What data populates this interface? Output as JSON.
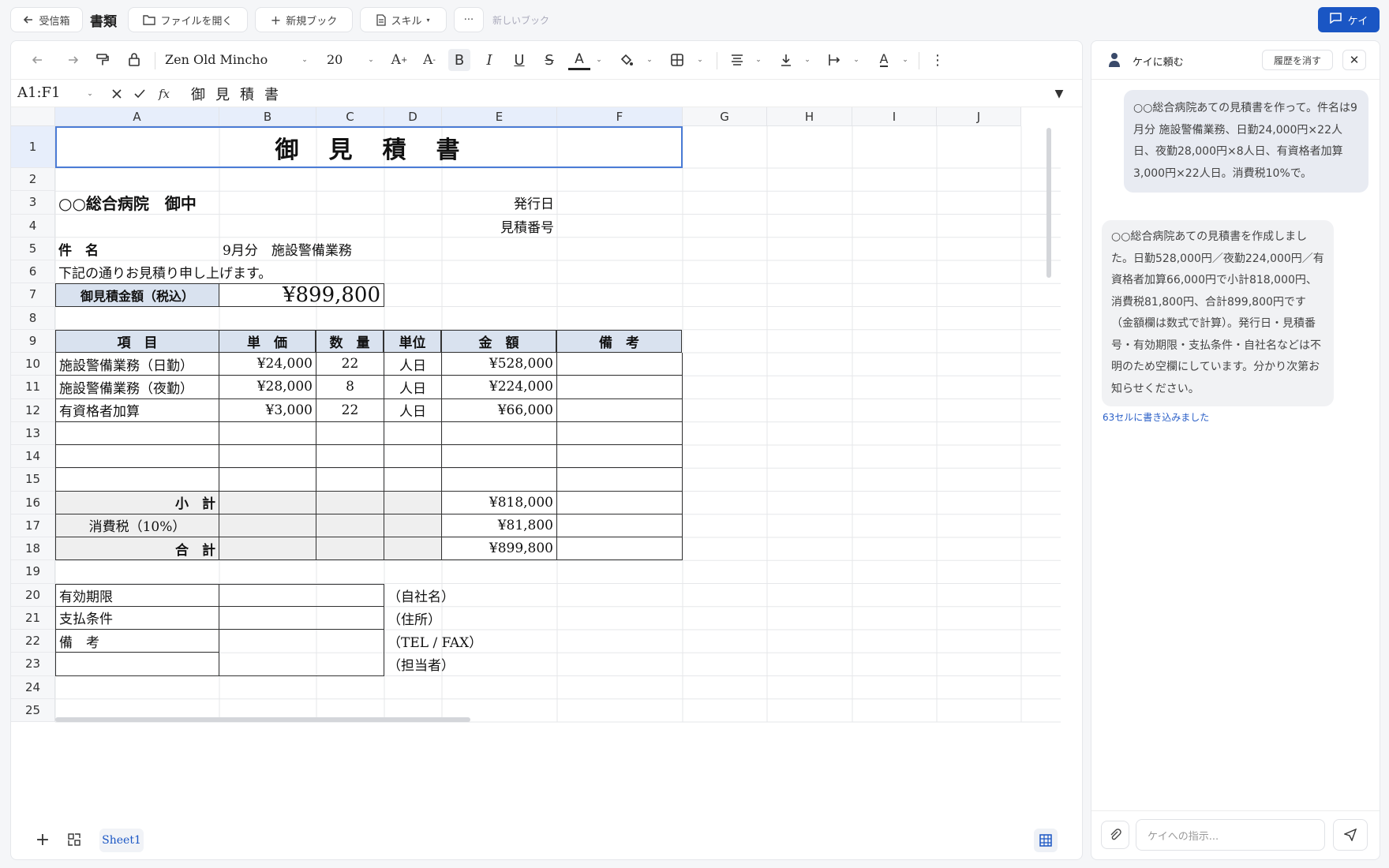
{
  "topbar": {
    "back_label": "受信箱",
    "app_title": "書類",
    "open_file": "ファイルを開く",
    "new_book": "新規ブック",
    "skill": "スキル",
    "more": "···",
    "doc_name": "新しいブック",
    "kei_button": "ケイ"
  },
  "toolbar": {
    "font_name": "Zen Old Mincho",
    "font_size": "20"
  },
  "formula_bar": {
    "cell_ref": "A1:F1",
    "fx": "fx",
    "content": "御見積書"
  },
  "grid": {
    "columns": [
      "A",
      "B",
      "C",
      "D",
      "E",
      "F",
      "G",
      "H",
      "I",
      "J"
    ],
    "rows": [
      "1",
      "2",
      "3",
      "4",
      "5",
      "6",
      "7",
      "8",
      "9",
      "10",
      "11",
      "12",
      "13",
      "14",
      "15",
      "16",
      "17",
      "18",
      "19",
      "20",
      "21",
      "22",
      "23",
      "24",
      "25"
    ]
  },
  "sheet": {
    "title": "御　見　積　書",
    "recipient": "○○総合病院　御中",
    "issue_date_label": "発行日",
    "quote_no_label": "見積番号",
    "subject_label": "件　名",
    "subject_value": "9月分　施設警備業務",
    "intro": "下記の通りお見積り申し上げます。",
    "total_label": "御見積金額（税込）",
    "total_value": "¥899,800",
    "headers": [
      "項　目",
      "単　価",
      "数　量",
      "単位",
      "金　額",
      "備　考"
    ],
    "items": [
      {
        "name": "施設警備業務（日勤）",
        "price": "¥24,000",
        "qty": "22",
        "unit": "人日",
        "amount": "¥528,000"
      },
      {
        "name": "施設警備業務（夜勤）",
        "price": "¥28,000",
        "qty": "8",
        "unit": "人日",
        "amount": "¥224,000"
      },
      {
        "name": "有資格者加算",
        "price": "¥3,000",
        "qty": "22",
        "unit": "人日",
        "amount": "¥66,000"
      }
    ],
    "subtotal_label": "小　計",
    "subtotal_value": "¥818,000",
    "tax_label": "消費税（10%）",
    "tax_value": "¥81,800",
    "grand_label": "合　計",
    "grand_value": "¥899,800",
    "validity_label": "有効期限",
    "payment_label": "支払条件",
    "remarks_label": "備　考",
    "company_label": "（自社名）",
    "address_label": "（住所）",
    "tel_label": "（TEL / FAX）",
    "contact_label": "（担当者）"
  },
  "sidebar": {
    "title": "ケイに頼む",
    "clear_history": "履歴を消す",
    "user_message": "○○総合病院あての見積書を作って。件名は9月分 施設警備業務、日勤24,000円×22人日、夜勤28,000円×8人日、有資格者加算3,000円×22人日。消費税10%で。",
    "ai_message": "○○総合病院あての見積書を作成しました。日勤528,000円／夜勤224,000円／有資格者加算66,000円で小計818,000円、消費税81,800円、合計899,800円です（金額欄は数式で計算）。発行日・見積番号・有効期限・支払条件・自社名などは不明のため空欄にしています。分かり次第お知らせください。",
    "status": "63セルに書き込みました",
    "input_placeholder": "ケイへの指示..."
  },
  "bottom": {
    "sheet_tab": "Sheet1"
  }
}
